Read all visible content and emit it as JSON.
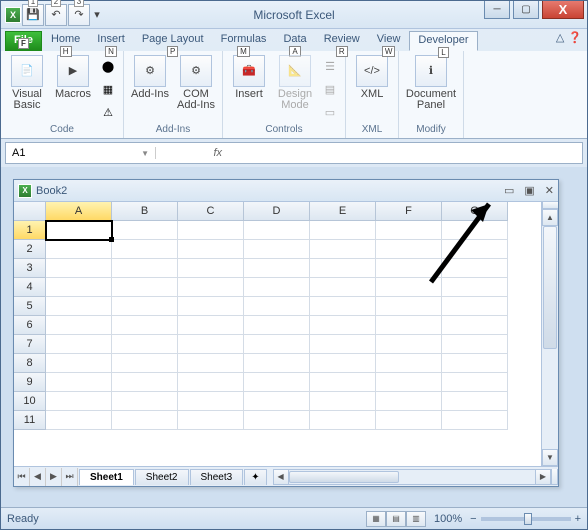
{
  "app": {
    "title": "Microsoft Excel"
  },
  "qat": {
    "items": [
      "1",
      "2",
      "3"
    ]
  },
  "tabs": {
    "file": {
      "label": "File",
      "key": "F"
    },
    "list": [
      {
        "label": "Home",
        "key": "H"
      },
      {
        "label": "Insert",
        "key": "N"
      },
      {
        "label": "Page Layout",
        "key": "P"
      },
      {
        "label": "Formulas",
        "key": "M"
      },
      {
        "label": "Data",
        "key": "A"
      },
      {
        "label": "Review",
        "key": "R"
      },
      {
        "label": "View",
        "key": "W"
      },
      {
        "label": "Developer",
        "key": "L"
      }
    ]
  },
  "ribbon": {
    "groups": [
      {
        "name": "Code",
        "items": [
          "Visual Basic",
          "Macros"
        ]
      },
      {
        "name": "Add-Ins",
        "items": [
          "Add-Ins",
          "COM Add-Ins"
        ]
      },
      {
        "name": "Controls",
        "items": [
          "Insert",
          "Design Mode"
        ]
      },
      {
        "name": "XML",
        "items": [
          "XML"
        ]
      },
      {
        "name": "Modify",
        "items": [
          "Document Panel"
        ]
      }
    ]
  },
  "namebox": {
    "ref": "A1",
    "fx": "fx",
    "formula": ""
  },
  "book": {
    "title": "Book2",
    "columns": [
      "A",
      "B",
      "C",
      "D",
      "E",
      "F",
      "G"
    ],
    "rows": [
      "1",
      "2",
      "3",
      "4",
      "5",
      "6",
      "7",
      "8",
      "9",
      "10",
      "11"
    ],
    "active": "A1",
    "sheets": [
      "Sheet1",
      "Sheet2",
      "Sheet3"
    ]
  },
  "status": {
    "text": "Ready",
    "zoom": "100%"
  },
  "winctrl": {
    "min": "─",
    "max": "▢",
    "close": "X"
  }
}
